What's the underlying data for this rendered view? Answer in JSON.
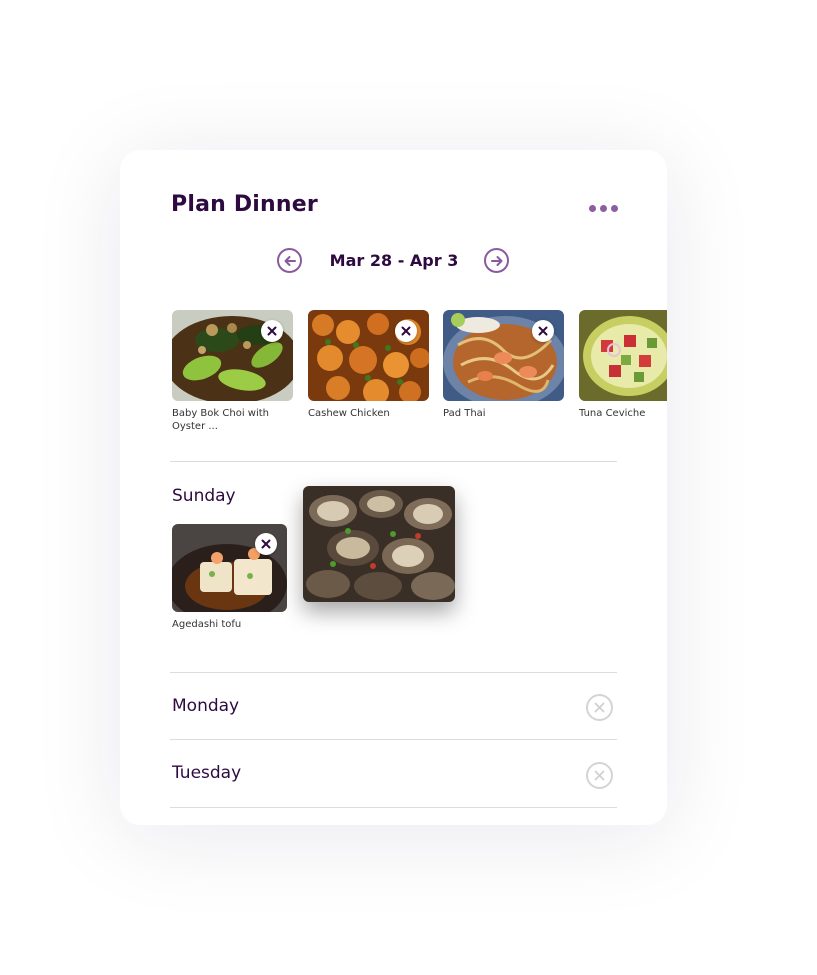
{
  "header": {
    "title": "Plan Dinner",
    "more_icon": "more-dots-icon"
  },
  "date_nav": {
    "range": "Mar 28 - Apr 3",
    "prev_icon": "arrow-left-circle-icon",
    "next_icon": "arrow-right-circle-icon"
  },
  "meals": [
    {
      "label": "Baby Bok Choi with Oyster ..."
    },
    {
      "label": "Cashew Chicken"
    },
    {
      "label": "Pad Thai"
    },
    {
      "label": "Tuna Ceviche"
    }
  ],
  "days": [
    {
      "name": "Sunday",
      "items": [
        {
          "label": "Agedashi tofu"
        }
      ]
    },
    {
      "name": "Monday",
      "items": []
    },
    {
      "name": "Tuesday",
      "items": []
    }
  ],
  "colors": {
    "accent": "#8a5b9c",
    "title": "#2d0a3f",
    "divider": "#dcdcdc"
  }
}
